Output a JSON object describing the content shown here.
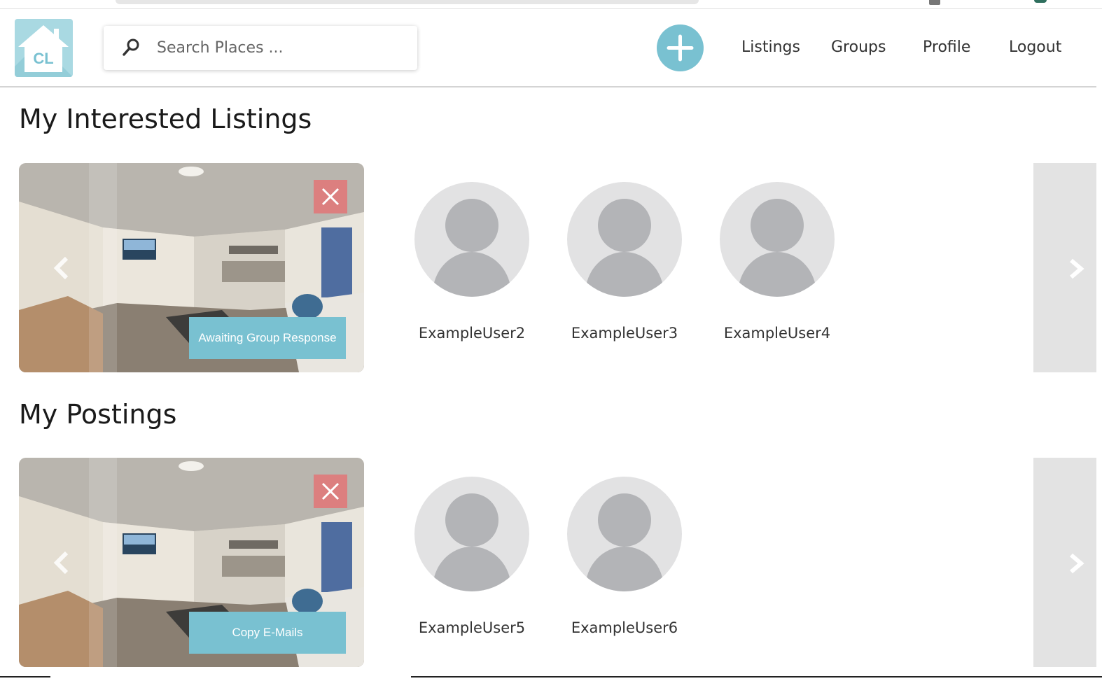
{
  "logo": {
    "text": "CL"
  },
  "search": {
    "placeholder": "Search Places ..."
  },
  "nav": {
    "add_button_icon": "plus-icon",
    "links": [
      "Listings",
      "Groups",
      "Profile",
      "Logout"
    ]
  },
  "sections": [
    {
      "title": "My Interested Listings",
      "card": {
        "action_label": "Awaiting Group Response",
        "close_icon": "close-icon"
      },
      "users": [
        "ExampleUser2",
        "ExampleUser3",
        "ExampleUser4"
      ]
    },
    {
      "title": "My Postings",
      "card": {
        "action_label": "Copy E-Mails",
        "close_icon": "close-icon"
      },
      "users": [
        "ExampleUser5",
        "ExampleUser6"
      ]
    }
  ],
  "colors": {
    "accent": "#79c1d1",
    "danger": "#dc7f7f",
    "panel": "#e3e3e3"
  }
}
